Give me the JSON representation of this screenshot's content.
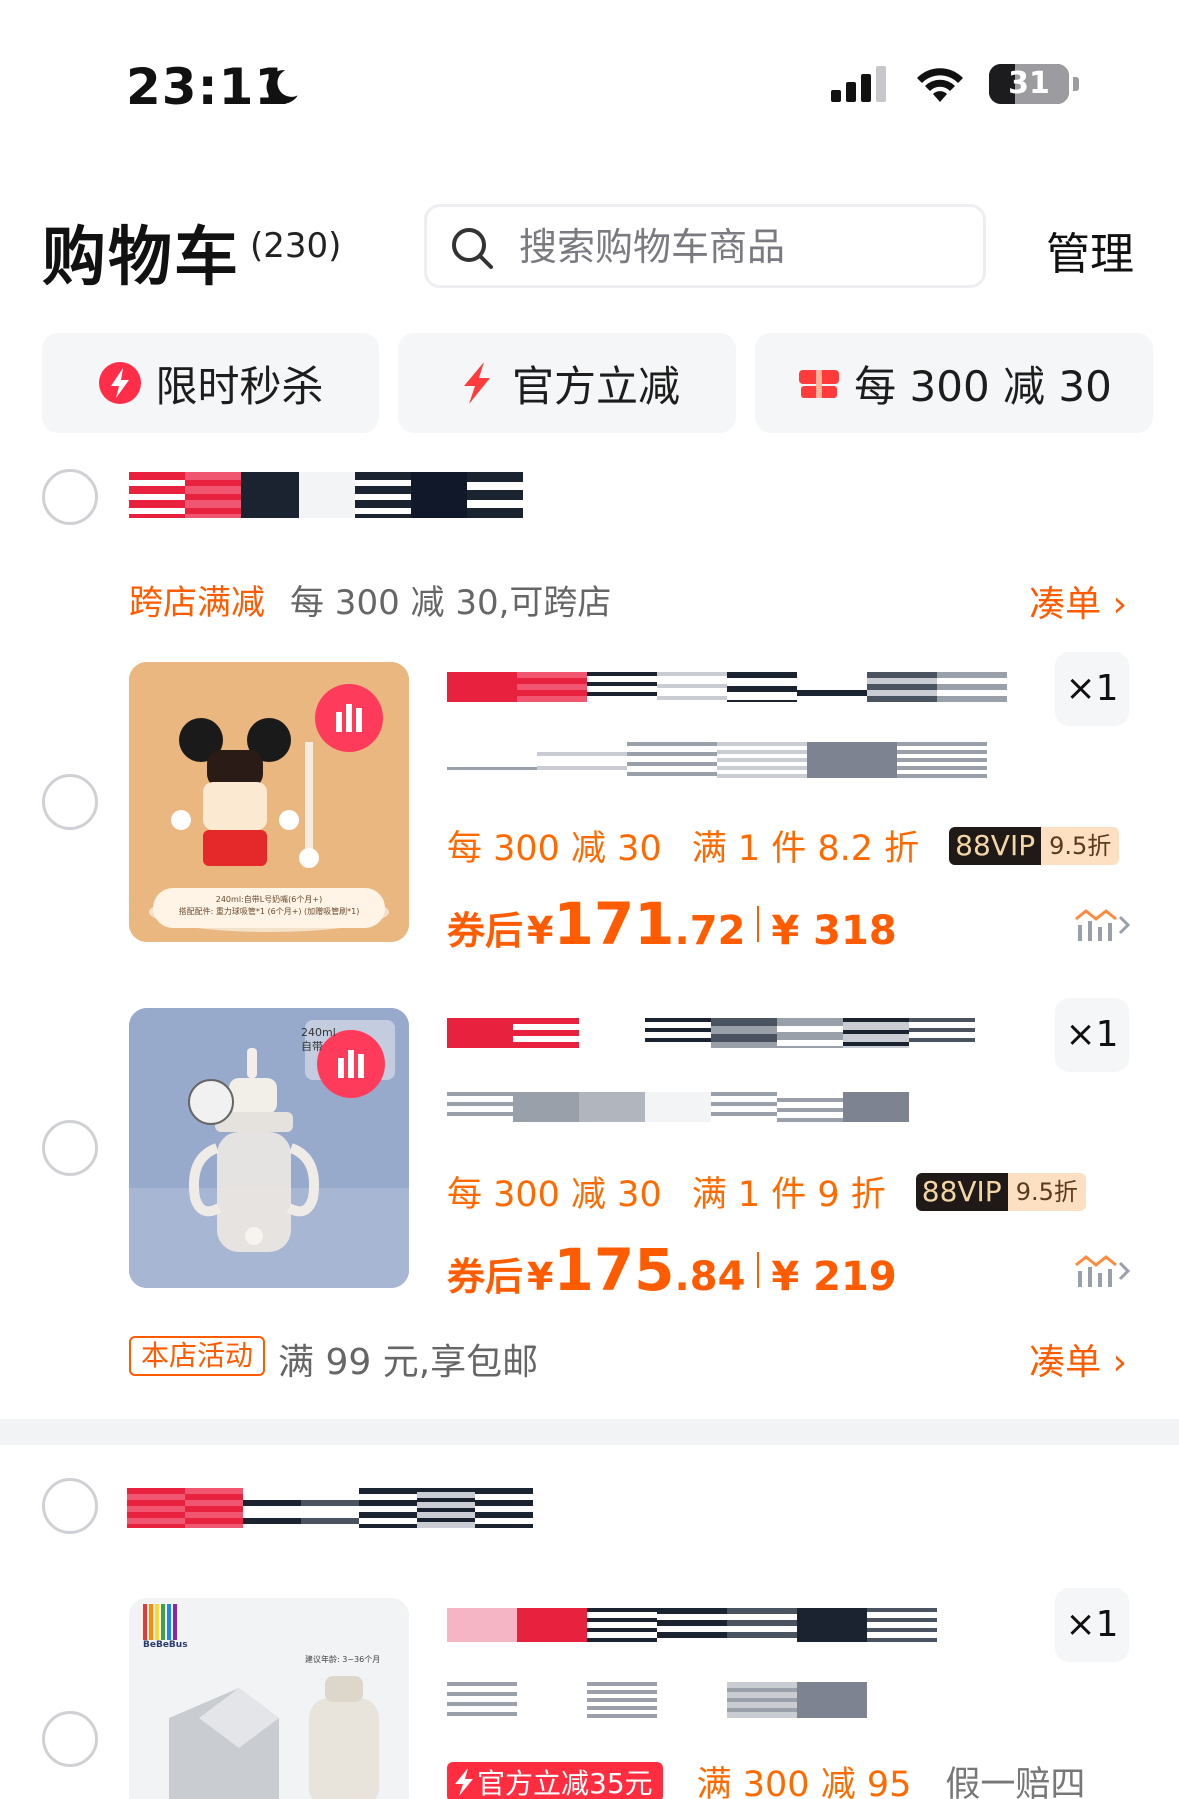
{
  "status_bar": {
    "time": "23:11",
    "battery": "31"
  },
  "header": {
    "title": "购物车",
    "count": "(230)",
    "search_placeholder": "搜索购物车商品",
    "manage": "管理"
  },
  "chips": [
    {
      "label": "限时秒杀",
      "icon": "flash-sale-icon"
    },
    {
      "label": "官方立减",
      "icon": "lightning-icon"
    },
    {
      "label": "每 300 减 30",
      "icon": "coupon-icon"
    }
  ],
  "shop1": {
    "promo_label": "跨店满减",
    "promo_text": "每 300 减 30,可跨店",
    "coudan": "凑单",
    "items": [
      {
        "qty": "×1",
        "promo": "每 300 减 30",
        "discount": "满 1 件 8.2 折",
        "vip": "88VIP",
        "vip_discount": "9.5折",
        "price_label": "券后",
        "yen": "¥",
        "price_int": "171",
        "price_dec": ".72",
        "orig": "¥ 318",
        "img_text_1": "240ml:自带L号奶嘴(6个月+)",
        "img_text_2": "搭配配件: 重力球吸管*1 (6个月+) (加赠吸管刷*1)"
      },
      {
        "qty": "×1",
        "promo": "每 300 减 30",
        "discount": "满 1 件 9 折",
        "vip": "88VIP",
        "vip_discount": "9.5折",
        "price_label": "券后",
        "yen": "¥",
        "price_int": "175",
        "price_dec": ".84",
        "orig": "¥ 219",
        "img_text_1": "240ml",
        "img_text_2": "自带"
      }
    ],
    "shop_activity_tag": "本店活动",
    "shop_activity_text": "满 99 元,享包邮",
    "coudan2": "凑单"
  },
  "shop2": {
    "items": [
      {
        "qty": "×1",
        "tag": "官方立减35元",
        "promo": "满 300 减 95",
        "extra": "假一赔四",
        "brand": "BeBeBus",
        "age": "建议年龄: 3~36个月"
      }
    ]
  }
}
